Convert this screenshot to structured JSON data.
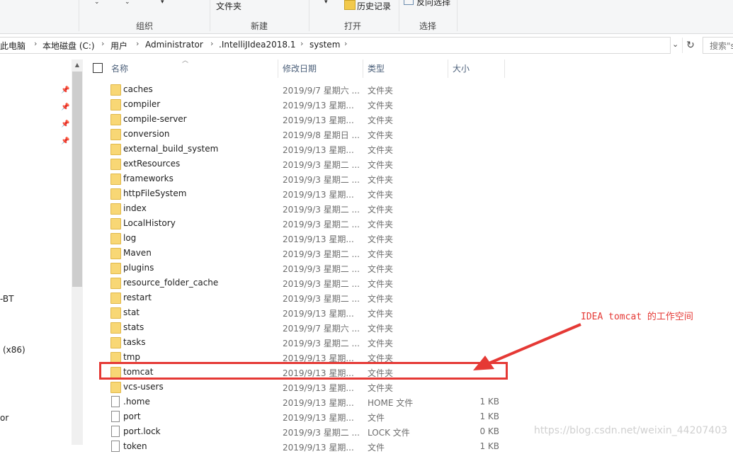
{
  "ribbon": {
    "file_folder": "文件夹",
    "history": "历史记录",
    "invert_select": "反向选择",
    "group_organize": "组织",
    "group_new": "新建",
    "group_open": "打开",
    "group_select": "选择"
  },
  "address": {
    "crumbs": [
      "此电脑",
      "本地磁盘 (C:)",
      "用户",
      "Administrator",
      ".IntelliJIdea2018.1",
      "system"
    ],
    "search_placeholder": "搜索\"sy"
  },
  "nav": {
    "labels": [
      "-BT",
      "(x86)",
      "or"
    ]
  },
  "columns": {
    "name": "名称",
    "date": "修改日期",
    "type": "类型",
    "size": "大小"
  },
  "rows": [
    {
      "name": "caches",
      "date": "2019/9/7 星期六 ...",
      "type": "文件夹",
      "size": "",
      "icon": "folder-icon"
    },
    {
      "name": "compiler",
      "date": "2019/9/13 星期...",
      "type": "文件夹",
      "size": "",
      "icon": "folder-icon"
    },
    {
      "name": "compile-server",
      "date": "2019/9/13 星期...",
      "type": "文件夹",
      "size": "",
      "icon": "folder-icon"
    },
    {
      "name": "conversion",
      "date": "2019/9/8 星期日 ...",
      "type": "文件夹",
      "size": "",
      "icon": "folder-icon"
    },
    {
      "name": "external_build_system",
      "date": "2019/9/13 星期...",
      "type": "文件夹",
      "size": "",
      "icon": "folder-icon"
    },
    {
      "name": "extResources",
      "date": "2019/9/3 星期二 ...",
      "type": "文件夹",
      "size": "",
      "icon": "folder-icon"
    },
    {
      "name": "frameworks",
      "date": "2019/9/3 星期二 ...",
      "type": "文件夹",
      "size": "",
      "icon": "folder-icon"
    },
    {
      "name": "httpFileSystem",
      "date": "2019/9/13 星期...",
      "type": "文件夹",
      "size": "",
      "icon": "folder-icon"
    },
    {
      "name": "index",
      "date": "2019/9/3 星期二 ...",
      "type": "文件夹",
      "size": "",
      "icon": "folder-icon"
    },
    {
      "name": "LocalHistory",
      "date": "2019/9/3 星期二 ...",
      "type": "文件夹",
      "size": "",
      "icon": "folder-icon"
    },
    {
      "name": "log",
      "date": "2019/9/13 星期...",
      "type": "文件夹",
      "size": "",
      "icon": "folder-icon"
    },
    {
      "name": "Maven",
      "date": "2019/9/3 星期二 ...",
      "type": "文件夹",
      "size": "",
      "icon": "folder-icon"
    },
    {
      "name": "plugins",
      "date": "2019/9/3 星期二 ...",
      "type": "文件夹",
      "size": "",
      "icon": "folder-icon"
    },
    {
      "name": "resource_folder_cache",
      "date": "2019/9/3 星期二 ...",
      "type": "文件夹",
      "size": "",
      "icon": "folder-icon"
    },
    {
      "name": "restart",
      "date": "2019/9/3 星期二 ...",
      "type": "文件夹",
      "size": "",
      "icon": "folder-icon"
    },
    {
      "name": "stat",
      "date": "2019/9/13 星期...",
      "type": "文件夹",
      "size": "",
      "icon": "folder-icon"
    },
    {
      "name": "stats",
      "date": "2019/9/7 星期六 ...",
      "type": "文件夹",
      "size": "",
      "icon": "folder-icon"
    },
    {
      "name": "tasks",
      "date": "2019/9/3 星期二 ...",
      "type": "文件夹",
      "size": "",
      "icon": "folder-icon"
    },
    {
      "name": "tmp",
      "date": "2019/9/13 星期...",
      "type": "文件夹",
      "size": "",
      "icon": "folder-icon"
    },
    {
      "name": "tomcat",
      "date": "2019/9/13 星期...",
      "type": "文件夹",
      "size": "",
      "icon": "folder-icon"
    },
    {
      "name": "vcs-users",
      "date": "2019/9/13 星期...",
      "type": "文件夹",
      "size": "",
      "icon": "folder-icon"
    },
    {
      "name": ".home",
      "date": "2019/9/13 星期...",
      "type": "HOME 文件",
      "size": "1 KB",
      "icon": "file-icon"
    },
    {
      "name": "port",
      "date": "2019/9/13 星期...",
      "type": "文件",
      "size": "1 KB",
      "icon": "file-icon"
    },
    {
      "name": "port.lock",
      "date": "2019/9/3 星期二 ...",
      "type": "LOCK 文件",
      "size": "0 KB",
      "icon": "file-icon"
    },
    {
      "name": "token",
      "date": "2019/9/13 星期...",
      "type": "文件",
      "size": "1 KB",
      "icon": "file-icon"
    }
  ],
  "annotation": {
    "text": "IDEA tomcat 的工作空间",
    "color": "#e53935"
  },
  "watermark": "https://blog.csdn.net/weixin_44207403"
}
